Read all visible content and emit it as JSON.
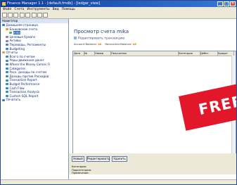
{
  "window": {
    "title": "Finance Manager 1.1 - [default.fmdb] - [ledger_view]",
    "controls": {
      "minimize": "_",
      "maximize": "□",
      "close": "×"
    }
  },
  "menubar": [
    "Файл",
    "Счета",
    "Инструменты",
    "Вид",
    "Помощь"
  ],
  "sidebar": {
    "header": "Навигатор",
    "items": [
      {
        "label": "Домашняя страница",
        "level": 0,
        "icon": "home-icon",
        "color": "#3c78d8"
      },
      {
        "label": "Банковские счета",
        "level": 1,
        "icon": "folder-icon",
        "color": "#d9a441"
      },
      {
        "label": "mika",
        "level": 2,
        "icon": "account-icon",
        "color": "#6aa84f",
        "selected": true
      },
      {
        "label": "Целевые бумаги",
        "level": 1,
        "icon": "stack-icon",
        "color": "#8e7cc3"
      },
      {
        "label": "Активы",
        "level": 1,
        "icon": "asset-icon",
        "color": "#8e7cc3"
      },
      {
        "label": "Переводы, Регламенты",
        "level": 1,
        "icon": "transfer-icon",
        "color": "#3d85c6"
      },
      {
        "label": "Budgeting",
        "level": 1,
        "icon": "budget-icon",
        "color": "#3d85c6"
      },
      {
        "label": "Отчеты",
        "level": 0,
        "icon": "folder-icon",
        "color": "#d9a441"
      },
      {
        "label": "Всего по счетам",
        "level": 1,
        "icon": "report-icon",
        "color": "#3d85c6"
      },
      {
        "label": "Ряды движения денег",
        "level": 1,
        "icon": "report-icon",
        "color": "#3d85c6"
      },
      {
        "label": "Where the Money Comes Fr",
        "level": 1,
        "icon": "report-icon",
        "color": "#3d85c6"
      },
      {
        "label": "Categories",
        "level": 1,
        "icon": "report-icon",
        "color": "#3d85c6"
      },
      {
        "label": "Расх. доходы по счетам",
        "level": 1,
        "icon": "report-icon",
        "color": "#3d85c6"
      },
      {
        "label": "Доходы против Расходов",
        "level": 1,
        "icon": "report-icon",
        "color": "#3d85c6"
      },
      {
        "label": "Transaction Report",
        "level": 1,
        "icon": "report-icon",
        "color": "#3d85c6"
      },
      {
        "label": "Budget Performance",
        "level": 1,
        "icon": "report-icon",
        "color": "#3d85c6"
      },
      {
        "label": "Cash Flow",
        "level": 1,
        "icon": "report-icon",
        "color": "#3d85c6"
      },
      {
        "label": "Transaction Analysis",
        "level": 1,
        "icon": "report-icon",
        "color": "#3d85c6"
      },
      {
        "label": "Custom SQL Report",
        "level": 1,
        "icon": "report-icon",
        "color": "#3d85c6"
      },
      {
        "label": "Печатать",
        "level": 0,
        "icon": "print-icon",
        "color": "#3c78d8"
      }
    ]
  },
  "main": {
    "title": "Просмотр счета mika",
    "subheader": "Редактировать транзакцию",
    "account_balance_label": "Account Balance:",
    "account_balance_value": "$0",
    "reconciled_balance_label": "Reconciled Balance:",
    "reconciled_balance_value": "$0",
    "grid_columns": [
      "Дата",
      "№",
      "Номер",
      "Получатель",
      "Категория",
      "Дебет",
      "Кредит"
    ],
    "banner_text": "FREE"
  },
  "bottom": {
    "buttons": [
      "Новый",
      "Редактировать",
      "Удалить"
    ],
    "props": [
      "Категория:",
      "Подкатегория:",
      "Примечание:"
    ]
  }
}
